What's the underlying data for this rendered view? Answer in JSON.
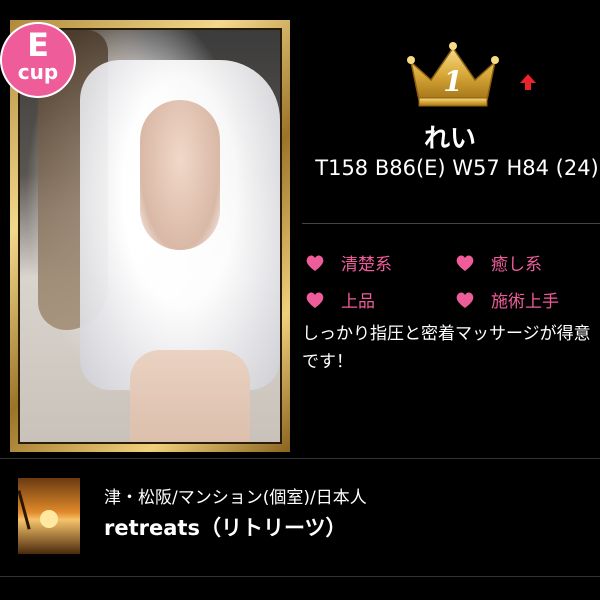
{
  "profile": {
    "cup_letter": "E",
    "cup_word": "cup",
    "rank": "1",
    "rank_trend": "up",
    "name": "れい",
    "measurements": "T158 B86(E) W57 H84 (24)",
    "tags": [
      "清楚系",
      "癒し系",
      "上品",
      "施術上手"
    ],
    "description": "しっかり指圧と密着マッサージが得意です！"
  },
  "shop": {
    "area": "津・松阪/マンション(個室)/日本人",
    "name": "retreats（リトリーツ）"
  },
  "colors": {
    "accent_pink": "#ee5d9a",
    "trend_red": "#e8232a",
    "crown_gold": "#d9a93a"
  },
  "icons": {
    "crown": "crown-icon",
    "trend": "arrow-up-icon",
    "tag": "heart-icon"
  }
}
